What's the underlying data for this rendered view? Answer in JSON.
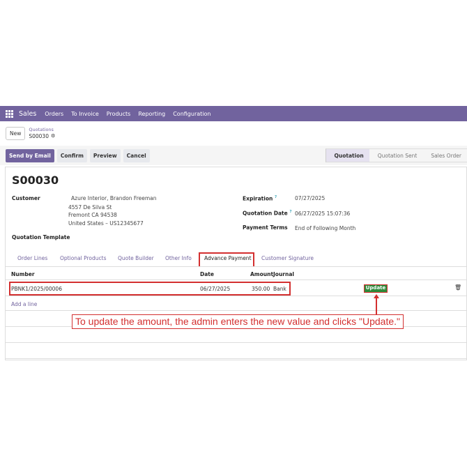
{
  "navbar": {
    "app": "Sales",
    "menus": [
      "Orders",
      "To Invoice",
      "Products",
      "Reporting",
      "Configuration"
    ]
  },
  "control": {
    "new_label": "New",
    "breadcrumb_parent": "Quotations",
    "breadcrumb_current": "S00030"
  },
  "actions": {
    "send_email": "Send by Email",
    "confirm": "Confirm",
    "preview": "Preview",
    "cancel": "Cancel"
  },
  "status": {
    "stages": [
      "Quotation",
      "Quotation Sent",
      "Sales Order"
    ],
    "active_stage": "Quotation"
  },
  "record": {
    "name": "S00030",
    "customer_label": "Customer",
    "customer_name": "Azure Interior, Brandon Freeman",
    "customer_address_1": "4557 De Silva St",
    "customer_address_2": "Fremont CA 94538",
    "customer_address_3": "United States – US12345677",
    "template_label": "Quotation Template",
    "expiration_label": "Expiration",
    "expiration_value": "07/27/2025",
    "quotation_date_label": "Quotation Date",
    "quotation_date_value": "06/27/2025 15:07:36",
    "payment_terms_label": "Payment Terms",
    "payment_terms_value": "End of Following Month",
    "help_mark": "?"
  },
  "tabs": [
    {
      "label": "Order Lines"
    },
    {
      "label": "Optional Products"
    },
    {
      "label": "Quote Builder"
    },
    {
      "label": "Other Info"
    },
    {
      "label": "Advance Payment"
    },
    {
      "label": "Customer Signature"
    }
  ],
  "table": {
    "headers": [
      "Number",
      "Date",
      "Amount",
      "Journal"
    ],
    "rows": [
      {
        "number": "PBNK1/2025/00006",
        "date": "06/27/2025",
        "amount": "350.00",
        "journal": "Bank",
        "action": "Update"
      }
    ],
    "add_line": "Add a line"
  },
  "annotation": "To update the amount, the admin enters the new value and clicks \"Update.\"",
  "colors": {
    "brand": "#71639e",
    "highlight": "#d32f2f",
    "update_button": "#2e8b3b"
  }
}
